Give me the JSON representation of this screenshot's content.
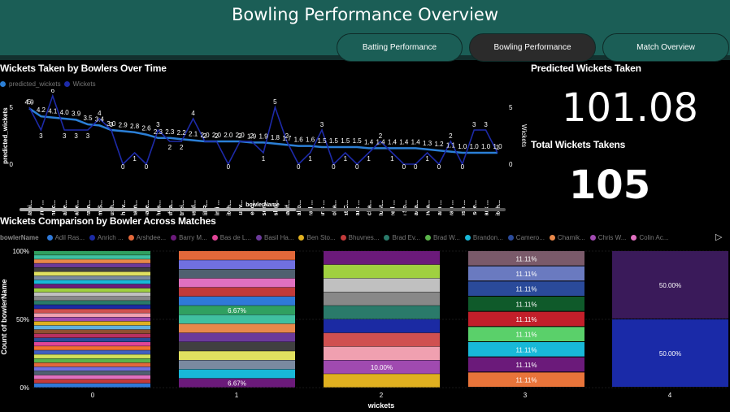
{
  "header": {
    "title": "Bowling Performance Overview",
    "nav": [
      {
        "label": "Batting Performance",
        "active": false
      },
      {
        "label": "Bowling Performance",
        "active": true
      },
      {
        "label": "Match Overview",
        "active": false
      }
    ]
  },
  "line_section": {
    "title": "Wickets Taken by Bowlers Over Time",
    "legend": [
      {
        "label": "predicted_wickets",
        "color": "#2b7fd6"
      },
      {
        "label": "Wickets",
        "color": "#1d2aa8"
      }
    ],
    "y_left_label": "predicted_wickets",
    "y_right_label": "Wickets",
    "x_label": "bowlerName"
  },
  "kpis": {
    "predicted_title": "Predicted Wickets Taken",
    "predicted_value": "101.08",
    "total_title": "Total Wickets Takens",
    "total_value": "105"
  },
  "bar_section": {
    "title": "Wickets Comparison by Bowler Across Matches",
    "legend_title": "bowlerName",
    "legend": [
      {
        "label": "Adil Ras...",
        "color": "#2f79d8"
      },
      {
        "label": "Anrich ...",
        "color": "#1b2aa3"
      },
      {
        "label": "Arshdee...",
        "color": "#e2683a"
      },
      {
        "label": "Barry M...",
        "color": "#6b1a7a"
      },
      {
        "label": "Bas de L...",
        "color": "#e04596"
      },
      {
        "label": "Basil Ha...",
        "color": "#6b3a9a"
      },
      {
        "label": "Ben Sto...",
        "color": "#e0b020"
      },
      {
        "label": "Bhuvnes...",
        "color": "#c23a3a"
      },
      {
        "label": "Brad Ev...",
        "color": "#2a7a6a"
      },
      {
        "label": "Brad W...",
        "color": "#5ab34a"
      },
      {
        "label": "Brandon...",
        "color": "#18b8d8"
      },
      {
        "label": "Camero...",
        "color": "#2a4a9a"
      },
      {
        "label": "Chamik...",
        "color": "#e8884a"
      },
      {
        "label": "Chris W...",
        "color": "#a04ab0"
      },
      {
        "label": "Colin Ac...",
        "color": "#e070c0"
      }
    ],
    "y_label": "Count of bowlerName",
    "x_label": "wickets"
  },
  "chart_data": [
    {
      "type": "line",
      "title": "Wickets Taken by Bowlers Over Time",
      "xlabel": "bowlerName",
      "ylabel": "predicted_wickets",
      "y2label": "Wickets",
      "categories": [
        "Wani...",
        "Barry ...",
        "Anric...",
        "Mahe...",
        "Shahe...",
        "Pram...",
        "Tim S...",
        "Dush...",
        "Bhuv...",
        "Cham...",
        "Gare...",
        "Chris...",
        "Safya...",
        "Otnei...",
        "Bas d...",
        "Adil R...",
        "Simi ...",
        "Mitch...",
        "Paul v...",
        "Reec...",
        "Kesun...",
        "Arshd...",
        "Sharif...",
        "Zaho...",
        "Brad ...",
        "Haris ...",
        "Moha...",
        "Pat C...",
        "Mark ...",
        "Richa...",
        "Must...",
        "Fred ...",
        "Ish So...",
        "Shada...",
        "Zewa...",
        "Liam ...",
        "Ryan ...",
        "Josh ...",
        "Nasee...",
        "Mark ...",
        "Mitch..."
      ],
      "series": [
        {
          "name": "predicted_wickets",
          "values": [
            4.9,
            4.2,
            4.1,
            4.0,
            3.9,
            3.5,
            3.4,
            3.0,
            2.9,
            2.8,
            2.6,
            2.3,
            2.3,
            2.2,
            2.1,
            2.0,
            2.0,
            2.0,
            2.0,
            1.9,
            1.9,
            1.8,
            1.7,
            1.6,
            1.6,
            1.5,
            1.5,
            1.5,
            1.5,
            1.4,
            1.4,
            1.4,
            1.4,
            1.4,
            1.3,
            1.2,
            1.1,
            1.0,
            1.0,
            1.0,
            1.0
          ],
          "labels": [
            "4.9",
            "4.2",
            "4.1",
            "4.0",
            "3.9",
            "3.5",
            "3.4",
            "3.0",
            "2.9",
            "2.8",
            "2.6",
            "2.3",
            "2.3",
            "2.2",
            "2.1",
            "2.0",
            "2.0",
            "2.0",
            "2.0",
            "1.9",
            "1.9",
            "1.8",
            "1.7",
            "1.6",
            "1.6",
            "1.5",
            "1.5",
            "1.5",
            "1.5",
            "1.4",
            "1.4",
            "1.4",
            "1.4",
            "1.4",
            "1.3",
            "1.2",
            "1.1",
            "1.0",
            "1.0",
            "1.0",
            "1.0"
          ]
        },
        {
          "name": "Wickets",
          "values": [
            5,
            3,
            6,
            3,
            3,
            3,
            4,
            3,
            0,
            1,
            0,
            3,
            2,
            2,
            4,
            2,
            2,
            0,
            2,
            2,
            1,
            5,
            2,
            0,
            1,
            3,
            0,
            1,
            0,
            1,
            2,
            1,
            0,
            0,
            1,
            0,
            2,
            0,
            3,
            3,
            1
          ]
        }
      ],
      "ylim": [
        0,
        5
      ],
      "y2lim": [
        0,
        5
      ],
      "yticks": [
        0,
        5
      ]
    },
    {
      "type": "bar",
      "title": "Wickets Comparison by Bowler Across Matches",
      "xlabel": "wickets",
      "ylabel": "Count of bowlerName",
      "categories": [
        "0",
        "1",
        "2",
        "3",
        "4"
      ],
      "stacked_percent": true,
      "segment_counts": [
        33,
        15,
        10,
        9,
        2
      ],
      "segment_labels": [
        [],
        [
          {
            "index": 0,
            "text": "6.67%"
          },
          {
            "index": 8,
            "text": "6.67%"
          }
        ],
        [
          {
            "index": 1,
            "text": "10.00%"
          }
        ],
        [
          {
            "index": 0,
            "text": "11.11%"
          },
          {
            "index": 1,
            "text": "11.11%"
          },
          {
            "index": 2,
            "text": "11.11%"
          },
          {
            "index": 3,
            "text": "11.11%"
          },
          {
            "index": 4,
            "text": "11.11%"
          },
          {
            "index": 5,
            "text": "11.11%"
          },
          {
            "index": 6,
            "text": "11.11%"
          },
          {
            "index": 7,
            "text": "11.11%"
          },
          {
            "index": 8,
            "text": "11.11%"
          }
        ],
        [
          {
            "index": 0,
            "text": "50.00%"
          },
          {
            "index": 1,
            "text": "50.00%"
          }
        ]
      ],
      "yticks": [
        "0%",
        "50%",
        "100%"
      ]
    }
  ]
}
